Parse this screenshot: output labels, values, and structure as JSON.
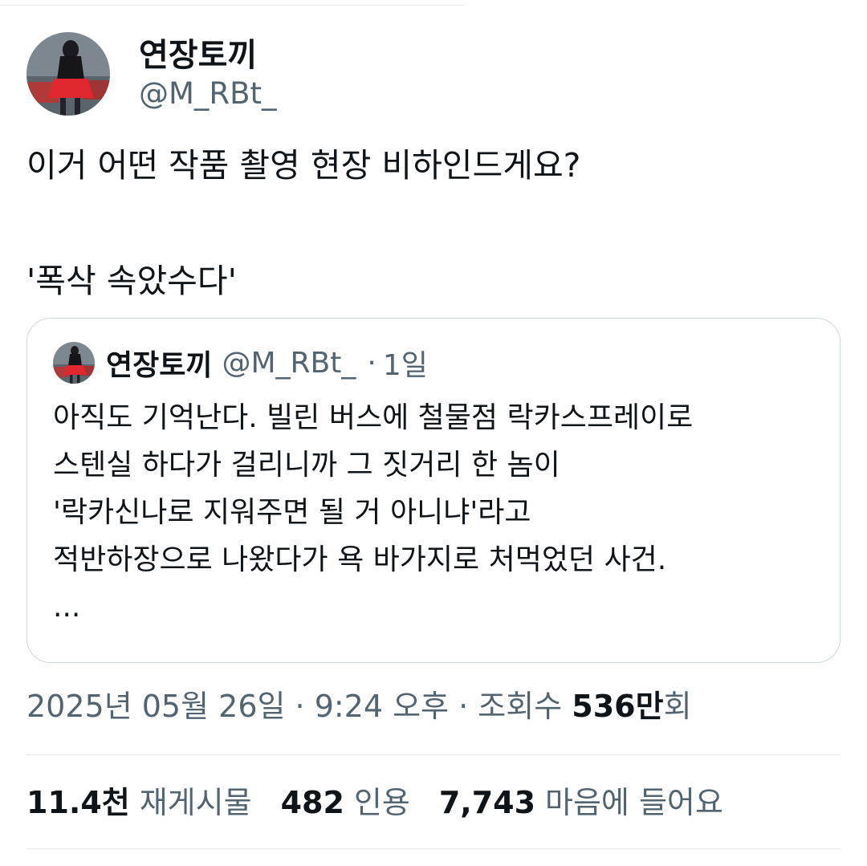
{
  "author": {
    "display_name": "연장토끼",
    "handle": "@M_RBt_"
  },
  "tweet": {
    "lines": [
      "이거 어떤 작품 촬영 현장 비하인드게요?",
      "'폭삭 속았수다'"
    ]
  },
  "quoted_tweet": {
    "display_name": "연장토끼",
    "handle": "@M_RBt_",
    "separator": "·",
    "time_ago": "1일",
    "lines": [
      "아직도 기억난다. 빌린 버스에 철물점 락카스프레이로",
      "스텐실 하다가 걸리니까 그 짓거리 한 놈이",
      "'락카신나로 지워주면 될 거 아니냐'라고",
      "적반하장으로 나왔다가 욕 바가지로 처먹었던 사건.",
      "..."
    ]
  },
  "meta": {
    "date": "2025년 05월 26일",
    "time": "9:24 오후",
    "separator": " · ",
    "views_label": "조회수",
    "views_number": "536만",
    "views_suffix": "회"
  },
  "stats": {
    "reposts_count": "11.4천",
    "reposts_label": "재게시물",
    "quotes_count": "482",
    "quotes_label": "인용",
    "likes_count": "7,743",
    "likes_label": "마음에 들어요"
  },
  "colors": {
    "text_primary": "#0f1419",
    "text_secondary": "#536471",
    "border": "#cfd9de",
    "divider": "#e7e9ea"
  }
}
